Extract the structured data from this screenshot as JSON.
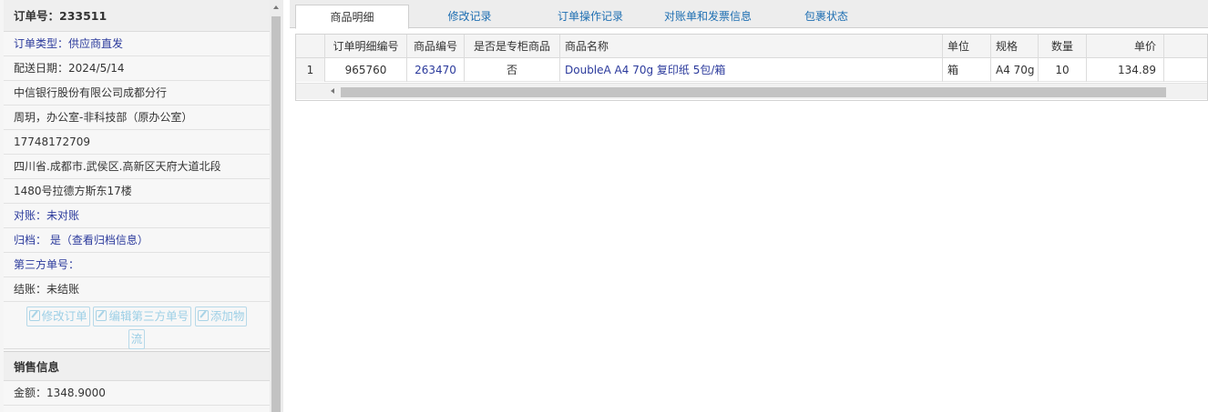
{
  "order": {
    "title": "订单号：233511",
    "type": "订单类型：供应商直发",
    "delivery_date": "配送日期：2024/5/14",
    "company": "中信银行股份有限公司成都分行",
    "contact": "周玥，办公室-非科技部（原办公室）",
    "phone": "17748172709",
    "address_1": "四川省.成都市.武侯区.高新区天府大道北段",
    "address_2": "1480号拉德方斯东17楼",
    "reconcile": "对账：未对账",
    "archive": "归档： 是（查看归档信息）",
    "third_party_no": "第三方单号：",
    "settlement": "结账：未结账"
  },
  "actions": {
    "edit_order": "修改订单",
    "edit_third_party": "编辑第三方单号",
    "add_logistics_line1": "添加物",
    "add_logistics_line2": "流"
  },
  "sales": {
    "title": "销售信息",
    "amount": "金额：1348.9000"
  },
  "tabs": [
    "商品明细",
    "修改记录",
    "订单操作记录",
    "对账单和发票信息",
    "包裹状态"
  ],
  "grid": {
    "headers": [
      "订单明细编号",
      "商品编号",
      "是否是专柜商品",
      "商品名称",
      "单位",
      "规格",
      "数量",
      "单价"
    ],
    "row": {
      "index": "1",
      "detail_no": "965760",
      "product_no": "263470",
      "counter": "否",
      "name": "DoubleA A4 70g 复印纸 5包/箱",
      "unit": "箱",
      "spec": "A4 70g",
      "qty": "10",
      "price": "134.89"
    }
  },
  "colors": {
    "link": "#2b3a9c",
    "tab_link": "#1f6fb2",
    "ghost_button": "#9ccfe6"
  }
}
